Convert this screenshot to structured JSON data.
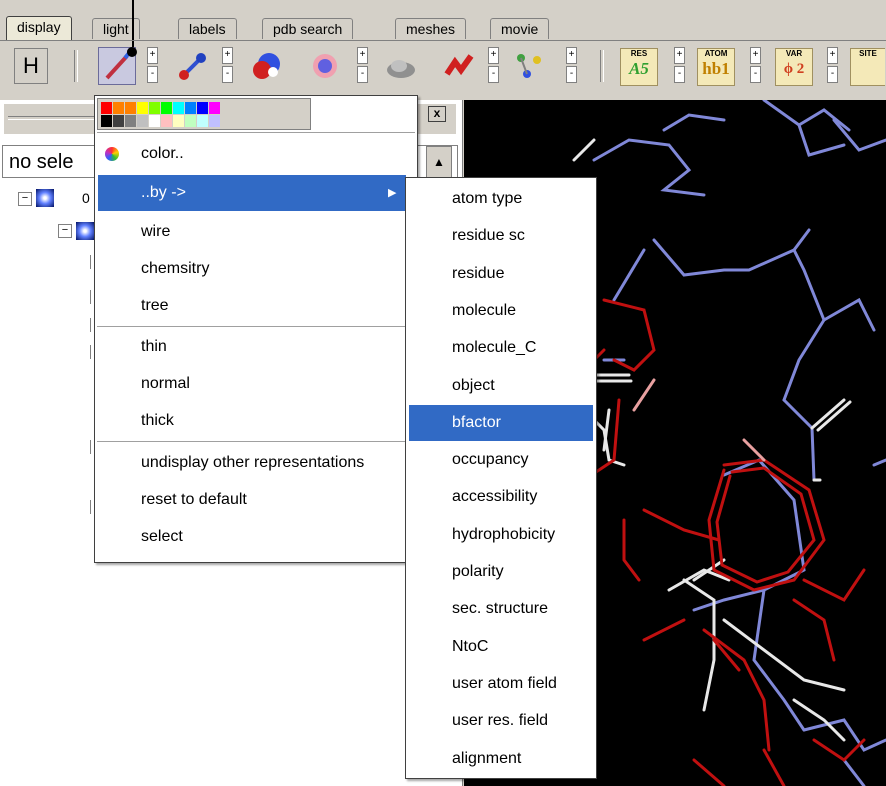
{
  "tabs": [
    "display",
    "light",
    "labels",
    "pdb search",
    "meshes",
    "movie"
  ],
  "toolbar": {
    "h_button": "H",
    "plus": "+",
    "minus": "-",
    "res_label": {
      "top": "RES",
      "bottom": "A5"
    },
    "atom_label": {
      "top": "ATOM",
      "bottom": "hb1"
    },
    "var_label": {
      "top": "VAR",
      "bottom": "ϕ 2"
    },
    "site_label": {
      "top": "SITE",
      "bottom": ""
    }
  },
  "panel": {
    "selection_text": "no sele",
    "close_glyph": "x",
    "scroll_up_glyph": "▲",
    "tree_item_label": "0"
  },
  "color_menu": {
    "palette_row1": [
      "#ff0000",
      "#ff8000",
      "#ff8000",
      "#ffff00",
      "#80ff00",
      "#00ff00",
      "#00ffff",
      "#0080ff",
      "#0000ff",
      "#ff00ff"
    ],
    "palette_row2": [
      "#000000",
      "#404040",
      "#808080",
      "#c0c0c0",
      "#ffffff",
      "#ffc0c0",
      "#ffffc0",
      "#c0ffc0",
      "#c0ffff",
      "#c0c0ff"
    ],
    "items": [
      "color..",
      "..by ->",
      "wire",
      "chemsitry",
      "tree",
      "thin",
      "normal",
      "thick",
      "undisplay other representations",
      "reset to default",
      "select"
    ],
    "highlighted": "..by ->",
    "submenu_arrow": "▶"
  },
  "by_submenu": {
    "items": [
      "atom type",
      "residue sc",
      "residue",
      "molecule",
      "molecule_C",
      "object",
      "bfactor",
      "occupancy",
      "accessibility",
      "hydrophobicity",
      "polarity",
      "sec. structure",
      "NtoC",
      "user atom field",
      "user res. field",
      "alignment"
    ],
    "highlighted": "bfactor"
  },
  "colors": {
    "menu_highlight": "#316ac5",
    "viewer_bg": "#000000",
    "bond_blue": "#8088d8",
    "bond_red": "#c01010",
    "bond_white": "#e8e8e8"
  }
}
